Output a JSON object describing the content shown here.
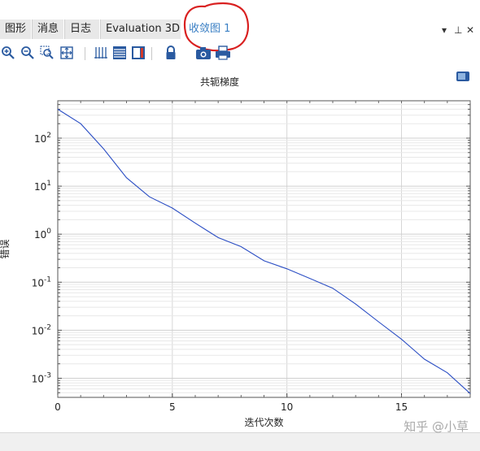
{
  "tabs": [
    {
      "label": "图形",
      "active": false
    },
    {
      "label": "消息",
      "active": false
    },
    {
      "label": "日志",
      "active": false
    },
    {
      "label": "Evaluation 3D",
      "active": false
    },
    {
      "label": "收敛图 1",
      "active": true
    }
  ],
  "window_controls": {
    "menu": "▾",
    "pin": "⊥",
    "close": "✕"
  },
  "toolbar_icons": [
    "zoom-in-icon",
    "zoom-out-icon",
    "zoom-box-icon",
    "zoom-extents-icon",
    "grid-icon",
    "table-icon",
    "legend-icon",
    "lock-icon",
    "camera-icon",
    "print-icon"
  ],
  "plot": {
    "title": "共轭梯度"
  },
  "watermark": "知乎 @小草",
  "colors": {
    "line": "#2b4ec4",
    "active_tab": "#3a7fc4",
    "annotation": "#d92020"
  },
  "chart_data": {
    "type": "line",
    "title": "共轭梯度",
    "xlabel": "迭代次数",
    "ylabel": "错误",
    "yscale": "log",
    "xlim": [
      0,
      18
    ],
    "ylim": [
      0.0004,
      600
    ],
    "xticks": [
      "0",
      "5",
      "10",
      "15"
    ],
    "yticks": [
      {
        "base": "10",
        "exp": "2",
        "value": 100
      },
      {
        "base": "10",
        "exp": "1",
        "value": 10
      },
      {
        "base": "10",
        "exp": "0",
        "value": 1
      },
      {
        "base": "10",
        "exp": "-1",
        "value": 0.1
      },
      {
        "base": "10",
        "exp": "-2",
        "value": 0.01
      },
      {
        "base": "10",
        "exp": "-3",
        "value": 0.001
      }
    ],
    "grid": true,
    "series": [
      {
        "x": [
          0,
          1,
          2,
          3,
          4,
          5,
          6,
          7,
          8,
          9,
          10,
          11,
          12,
          13,
          14,
          15,
          16,
          17,
          18
        ],
        "y": [
          400,
          200,
          60,
          15,
          6,
          3.5,
          1.7,
          0.85,
          0.55,
          0.28,
          0.19,
          0.12,
          0.075,
          0.035,
          0.015,
          0.0065,
          0.0025,
          0.0013,
          0.00048
        ]
      }
    ]
  }
}
